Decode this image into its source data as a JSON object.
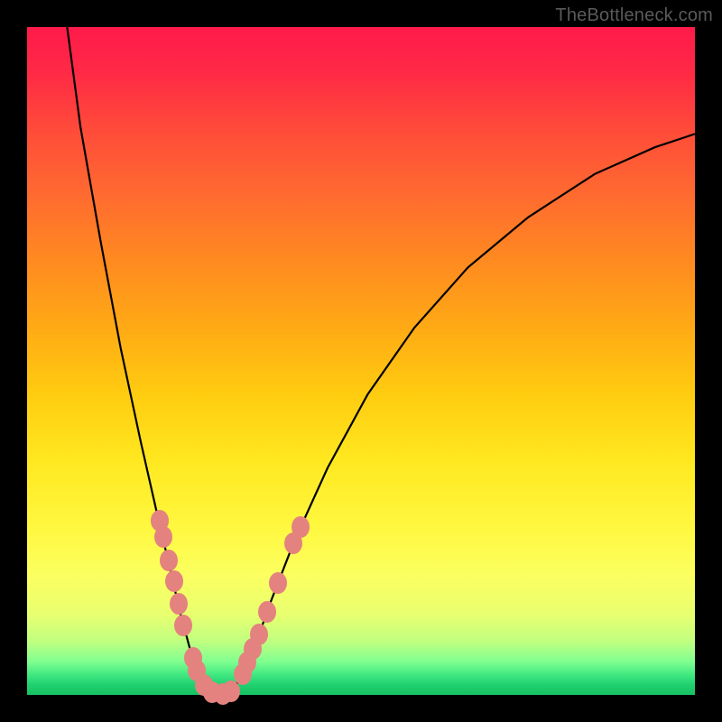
{
  "watermark": "TheBottleneck.com",
  "chart_data": {
    "type": "line",
    "title": "",
    "xlabel": "",
    "ylabel": "",
    "xlim": [
      0,
      100
    ],
    "ylim": [
      0,
      100
    ],
    "curve": [
      {
        "x": 6.0,
        "y": 100.0
      },
      {
        "x": 8.0,
        "y": 85.0
      },
      {
        "x": 11.0,
        "y": 68.0
      },
      {
        "x": 14.0,
        "y": 52.0
      },
      {
        "x": 17.0,
        "y": 38.0
      },
      {
        "x": 19.5,
        "y": 27.0
      },
      {
        "x": 21.5,
        "y": 18.5
      },
      {
        "x": 23.0,
        "y": 12.0
      },
      {
        "x": 24.5,
        "y": 6.5
      },
      {
        "x": 26.0,
        "y": 2.5
      },
      {
        "x": 27.5,
        "y": 0.5
      },
      {
        "x": 29.0,
        "y": 0.0
      },
      {
        "x": 30.5,
        "y": 0.5
      },
      {
        "x": 32.0,
        "y": 2.5
      },
      {
        "x": 34.0,
        "y": 7.0
      },
      {
        "x": 36.5,
        "y": 14.0
      },
      {
        "x": 40.0,
        "y": 23.0
      },
      {
        "x": 45.0,
        "y": 34.0
      },
      {
        "x": 51.0,
        "y": 45.0
      },
      {
        "x": 58.0,
        "y": 55.0
      },
      {
        "x": 66.0,
        "y": 64.0
      },
      {
        "x": 75.0,
        "y": 71.5
      },
      {
        "x": 85.0,
        "y": 78.0
      },
      {
        "x": 94.0,
        "y": 82.0
      },
      {
        "x": 100.0,
        "y": 84.0
      }
    ],
    "points_left": [
      {
        "x": 19.9,
        "y": 26.1
      },
      {
        "x": 20.4,
        "y": 23.7
      },
      {
        "x": 21.2,
        "y": 20.1
      },
      {
        "x": 22.0,
        "y": 17.0
      },
      {
        "x": 22.7,
        "y": 13.6
      },
      {
        "x": 23.4,
        "y": 10.4
      },
      {
        "x": 24.8,
        "y": 5.5
      },
      {
        "x": 25.4,
        "y": 3.7
      },
      {
        "x": 26.5,
        "y": 1.5
      },
      {
        "x": 27.7,
        "y": 0.4
      },
      {
        "x": 29.3,
        "y": 0.2
      },
      {
        "x": 30.5,
        "y": 0.5
      }
    ],
    "points_right": [
      {
        "x": 32.3,
        "y": 3.1
      },
      {
        "x": 33.0,
        "y": 4.9
      },
      {
        "x": 33.8,
        "y": 6.9
      },
      {
        "x": 34.7,
        "y": 9.1
      },
      {
        "x": 35.9,
        "y": 12.4
      },
      {
        "x": 37.5,
        "y": 16.7
      },
      {
        "x": 39.9,
        "y": 22.7
      },
      {
        "x": 40.9,
        "y": 25.2
      }
    ],
    "background_gradient": {
      "top": "#ff1a4a",
      "mid": "#ffe820",
      "bottom": "#18c060"
    }
  }
}
